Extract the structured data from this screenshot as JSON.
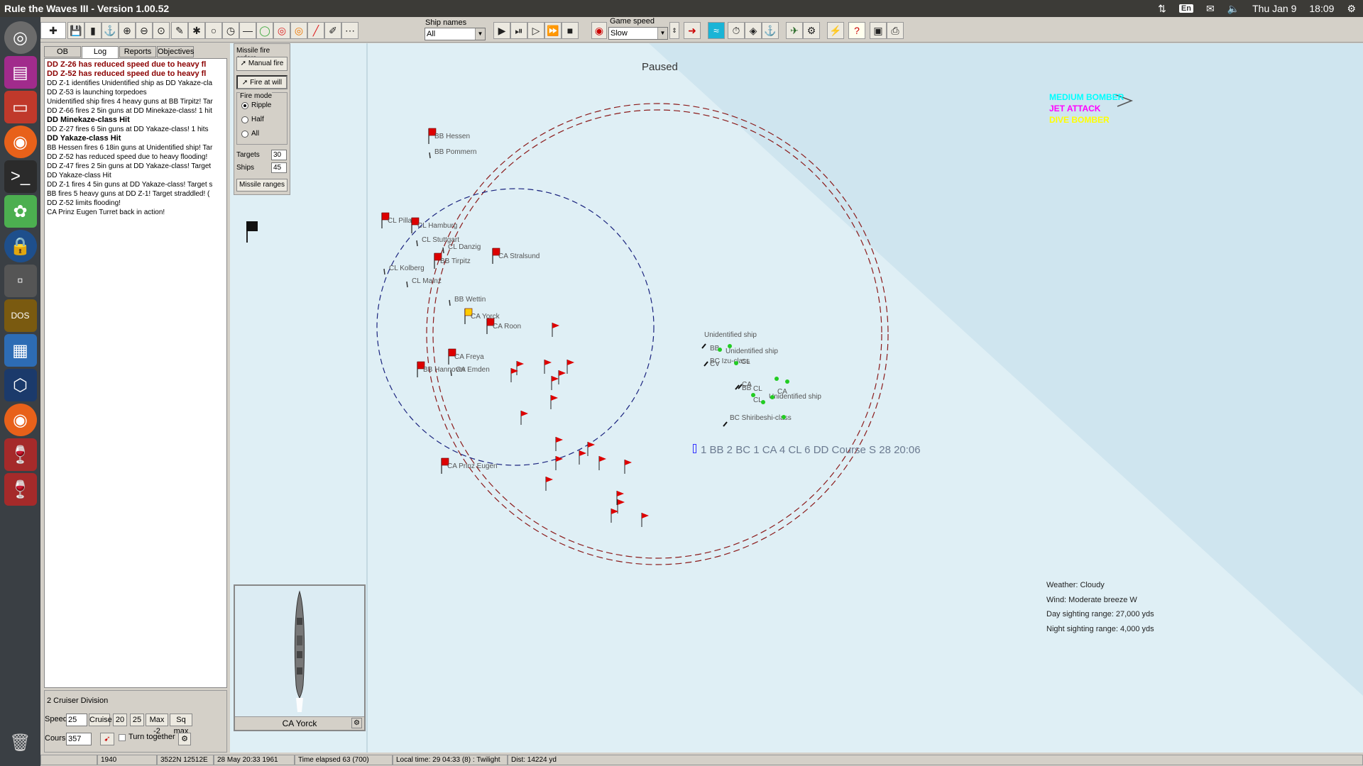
{
  "system": {
    "window_title": "Rule the Waves III - Version 1.00.52",
    "lang": "En",
    "clock_day": "Thu Jan 9",
    "clock_time": "18:09"
  },
  "toolbar": {
    "ship_names_label": "Ship names",
    "ship_names_value": "All",
    "game_speed_label": "Game speed",
    "game_speed_value": "Slow"
  },
  "left_panel": {
    "tabs": [
      "OB",
      "Log",
      "Reports",
      "Objectives"
    ],
    "log": [
      {
        "text": "DD Z-26 has reduced speed due to heavy fl",
        "style": "red"
      },
      {
        "text": "DD Z-52 has reduced speed due to heavy fl",
        "style": "red"
      },
      {
        "text": "DD Z-1 identifies Unidentified ship as DD Yakaze-cla",
        "style": ""
      },
      {
        "text": "DD Z-53 is launching torpedoes",
        "style": ""
      },
      {
        "text": "Unidentified ship fires 4 heavy guns at BB Tirpitz! Tar",
        "style": ""
      },
      {
        "text": "DD Z-66 fires 2 5in guns at DD Minekaze-class! 1 hit",
        "style": ""
      },
      {
        "text": "DD Minekaze-class Hit",
        "style": "bold"
      },
      {
        "text": "DD Z-27 fires 6 5in guns at DD Yakaze-class! 1 hits",
        "style": ""
      },
      {
        "text": "DD Yakaze-class Hit",
        "style": "bold"
      },
      {
        "text": "BB Hessen fires 6 18in guns at Unidentified ship! Tar",
        "style": ""
      },
      {
        "text": "DD Z-52 has reduced speed due to heavy flooding!",
        "style": ""
      },
      {
        "text": "DD Z-47 fires 2 5in guns at DD Yakaze-class! Target",
        "style": ""
      },
      {
        "text": "DD Yakaze-class Hit",
        "style": ""
      },
      {
        "text": "DD Z-1 fires 4 5in guns at DD Yakaze-class! Target s",
        "style": ""
      },
      {
        "text": "BB fires 5 heavy guns at DD Z-1! Target straddled!  (",
        "style": ""
      },
      {
        "text": "DD Z-52 limits flooding!",
        "style": ""
      },
      {
        "text": "CA Prinz Eugen Turret back in action!",
        "style": ""
      }
    ],
    "division": {
      "name": "2 Cruiser Division",
      "speed_label": "Speed",
      "speed_value": "25",
      "buttons": [
        "Cruise",
        "20",
        "25",
        "Max -2",
        "Sq max"
      ],
      "course_label": "Course",
      "course_value": "357",
      "turn_together": "Turn together"
    }
  },
  "missile": {
    "title": "Missile fire orders",
    "manual_fire": "Manual fire",
    "fire_at_will": "Fire at will",
    "fire_mode_label": "Fire mode",
    "modes": [
      "Ripple",
      "Half",
      "All"
    ],
    "selected_mode": "Ripple",
    "targets_label": "Targets",
    "targets_value": "30",
    "ships_label": "Ships",
    "ships_value": "45",
    "missile_ranges": "Missile ranges"
  },
  "minimap": {
    "ship_label": "CA Yorck"
  },
  "map": {
    "paused": "Paused",
    "air_missions": [
      {
        "text": "MEDIUM BOMBER",
        "color": "#00ffff"
      },
      {
        "text": "JET ATTACK",
        "color": "#ff00ff"
      },
      {
        "text": "DIVE BOMBER",
        "color": "#ffff00"
      }
    ],
    "ships": [
      {
        "name": "BB Hessen",
        "flag": true
      },
      {
        "name": "BB Pommern",
        "flag": false
      },
      {
        "name": "CL Pillau",
        "flag": true
      },
      {
        "name": "CL Hamburg",
        "flag": true
      },
      {
        "name": "CL Stuttgart",
        "flag": false
      },
      {
        "name": "CL Danzig",
        "flag": false
      },
      {
        "name": "CA Stralsund",
        "flag": true
      },
      {
        "name": "BB Tirpitz",
        "flag": true
      },
      {
        "name": "CL Kolberg",
        "flag": false
      },
      {
        "name": "CL Mainz",
        "flag": false
      },
      {
        "name": "BB Wettin",
        "flag": false
      },
      {
        "name": "CA Yorck",
        "flag": true,
        "flag_color": "#ffcc00"
      },
      {
        "name": "CA Roon",
        "flag": true
      },
      {
        "name": "CA Freya",
        "flag": true
      },
      {
        "name": "BB Hannover",
        "flag": true
      },
      {
        "name": "CA Emden",
        "flag": false
      },
      {
        "name": "CA Prinz Eugen",
        "flag": true
      }
    ],
    "enemy_labels": [
      "Unidentified ship",
      "BB",
      "Unidentified ship",
      "BC Izu-class",
      "CL",
      "CV",
      "CA",
      "BB",
      "CL",
      "CA",
      "CL",
      "Unidentified ship",
      "BC Shiribeshi-class"
    ],
    "contact_report": "1 BB 2 BC 1 CA 4 CL 6 DD Course S 28 20:06",
    "weather": {
      "weather": "Weather: Cloudy",
      "wind": "Wind: Moderate breeze  W",
      "day_range": "Day sighting range: 27,000 yds",
      "night_range": "Night sighting range: 4,000 yds"
    }
  },
  "status_bar": [
    "",
    "1940",
    "3522N 12512E",
    "28 May 20:33 1961",
    "Time elapsed 63 (700)",
    "Local time: 29 04:33 (8) : Twilight",
    "Dist: 14224 yd"
  ],
  "colors": {
    "sea": "#dfeff5",
    "friendly_flag": "#dd0000",
    "enemy_dot": "#22cc22",
    "range_red": "#8b1a1a",
    "range_blue": "#1a237e"
  }
}
